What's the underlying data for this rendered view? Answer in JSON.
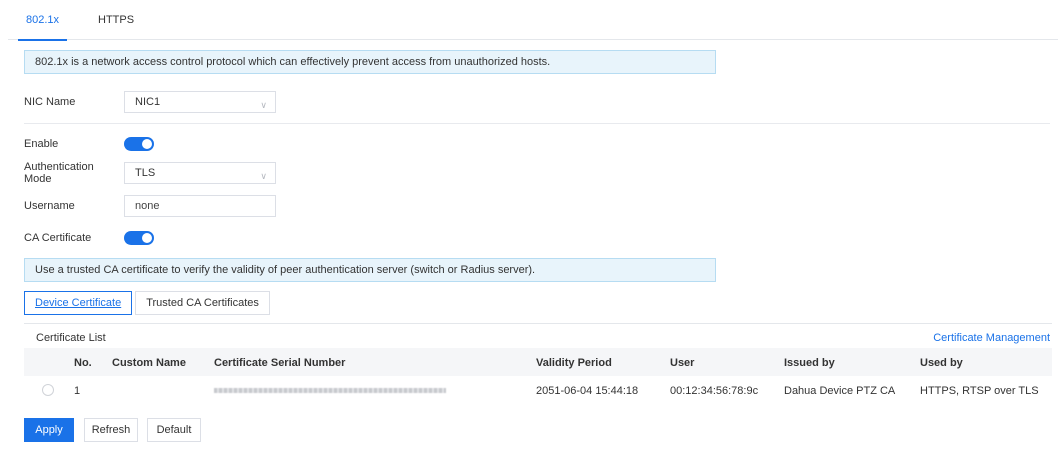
{
  "tabs": [
    {
      "label": "802.1x",
      "active": true
    },
    {
      "label": "HTTPS",
      "active": false
    }
  ],
  "intro_banner": "802.1x is a network access control protocol which can effectively prevent access from unauthorized hosts.",
  "nic": {
    "label": "NIC Name",
    "value": "NIC1"
  },
  "enable": {
    "label": "Enable",
    "on": true
  },
  "auth_mode": {
    "label": "Authentication Mode",
    "value": "TLS"
  },
  "username": {
    "label": "Username",
    "value": "none"
  },
  "ca_cert": {
    "label": "CA Certificate",
    "on": true
  },
  "ca_banner": "Use a trusted CA certificate to verify the validity of peer authentication server (switch or Radius server).",
  "subtabs": [
    {
      "label": "Device Certificate",
      "active": true
    },
    {
      "label": "Trusted CA Certificates",
      "active": false
    }
  ],
  "cert_list": {
    "title": "Certificate List",
    "management_link": "Certificate Management",
    "columns": [
      "No.",
      "Custom Name",
      "Certificate Serial Number",
      "Validity Period",
      "User",
      "Issued by",
      "Used by"
    ],
    "rows": [
      {
        "no": "1",
        "custom_name": "",
        "serial": "",
        "validity": "2051-06-04 15:44:18",
        "user": "00:12:34:56:78:9c",
        "issued_by": "Dahua Device PTZ CA",
        "used_by": "HTTPS, RTSP over TLS"
      }
    ]
  },
  "buttons": {
    "apply": "Apply",
    "refresh": "Refresh",
    "default": "Default"
  },
  "colors": {
    "accent": "#1a72e8",
    "banner_bg": "#e8f4fb"
  }
}
